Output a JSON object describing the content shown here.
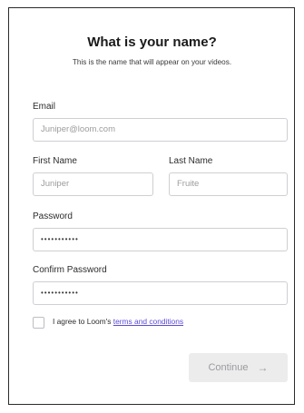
{
  "header": {
    "title": "What is your name?",
    "subtitle": "This is the name that will appear on your videos."
  },
  "form": {
    "email": {
      "label": "Email",
      "placeholder": "Juniper@loom.com"
    },
    "first_name": {
      "label": "First Name",
      "placeholder": "Juniper"
    },
    "last_name": {
      "label": "Last Name",
      "placeholder": "Fruite"
    },
    "password": {
      "label": "Password",
      "value": "•••••••••••"
    },
    "confirm_password": {
      "label": "Confirm Password",
      "value": "•••••••••••"
    },
    "agree": {
      "prefix": "I agree to Loom's ",
      "link_text": "terms and conditions",
      "checked": false
    },
    "continue": {
      "label": "Continue",
      "icon": "arrow-right-icon",
      "arrow_glyph": "→"
    }
  },
  "colors": {
    "link": "#5a4bd6",
    "button_bg": "#ececed",
    "button_text": "#9b9b9f",
    "input_border": "#cfcfd4"
  }
}
